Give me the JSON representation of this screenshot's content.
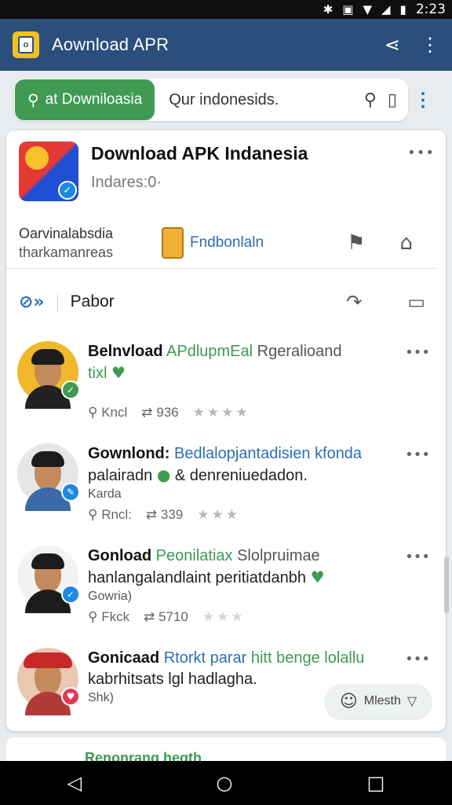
{
  "status_bar": {
    "time": "2:23"
  },
  "app_bar": {
    "title": "Aownload APR"
  },
  "search": {
    "button_label": "at Downiloasia",
    "query": "Qur indonesids."
  },
  "app_header": {
    "title": "Download APK Indanesia",
    "subtitle": "Indares:0·"
  },
  "meta": {
    "line1": "Oarvinalabsdia",
    "line2": "tharkamanreas",
    "link": "Fndbonlaln"
  },
  "action": {
    "label": "Pabor"
  },
  "posts": [
    {
      "author": "Belnvload",
      "tag": "APdlupmEal",
      "rest": "Rgeralioand",
      "line2": "tixl",
      "line3": "",
      "likes": "Kncl",
      "shares": "936",
      "badge_color": "#3f9a52"
    },
    {
      "author": "Gownlond:",
      "tag": "Bedlalopjantadisien kfonda",
      "rest": "",
      "line2": "palairadn",
      "line2b": "& denreniuedadon.",
      "line3": "Karda",
      "likes": "Rncl:",
      "shares": "339",
      "badge_color": "#1e88e5"
    },
    {
      "author": "Gonload",
      "tag": "Peonilatiax",
      "rest": "Slolpruimae",
      "line2": "hanlangalandlaint peritiatdanbh",
      "line3": "Gowria)",
      "likes": "Fkck",
      "shares": "5710",
      "badge_color": "#1e88e5"
    },
    {
      "author": "Gonicaad",
      "tag": "Rtorkt parar",
      "rest": "hitt benge lolallu",
      "line2": "kabrhitsats lgl hadlagha.",
      "line3": "Shk)",
      "likes": "",
      "shares": "",
      "badge_color": "#e53955"
    }
  ],
  "fab": {
    "label": "Mlesth"
  },
  "peek": {
    "text": "Renonrang hegth"
  }
}
